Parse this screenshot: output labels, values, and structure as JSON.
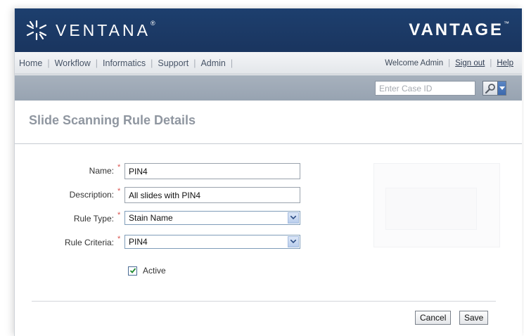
{
  "header": {
    "brand_left": "VENTANA",
    "brand_left_mark": "®",
    "brand_right": "VANTAGE",
    "brand_right_mark": "™"
  },
  "nav": {
    "items": [
      "Home",
      "Workflow",
      "Informatics",
      "Support",
      "Admin"
    ],
    "welcome": "Welcome Admin",
    "sign_out": "Sign out",
    "help": "Help"
  },
  "toolbar": {
    "case_placeholder": "Enter Case ID"
  },
  "page": {
    "title": "Slide Scanning Rule Details"
  },
  "form": {
    "name_label": "Name:",
    "name_value": "PIN4",
    "description_label": "Description:",
    "description_value": "All slides with PIN4",
    "rule_type_label": "Rule Type:",
    "rule_type_value": "Stain Name",
    "rule_criteria_label": "Rule Criteria:",
    "rule_criteria_value": "PIN4",
    "active_label": "Active",
    "active_checked": true,
    "required_mark": "*"
  },
  "actions": {
    "cancel": "Cancel",
    "save": "Save"
  },
  "colors": {
    "header_bg": "#1d3f6e",
    "toolbar_bg": "#a7b1bd",
    "required": "#d9534f"
  }
}
